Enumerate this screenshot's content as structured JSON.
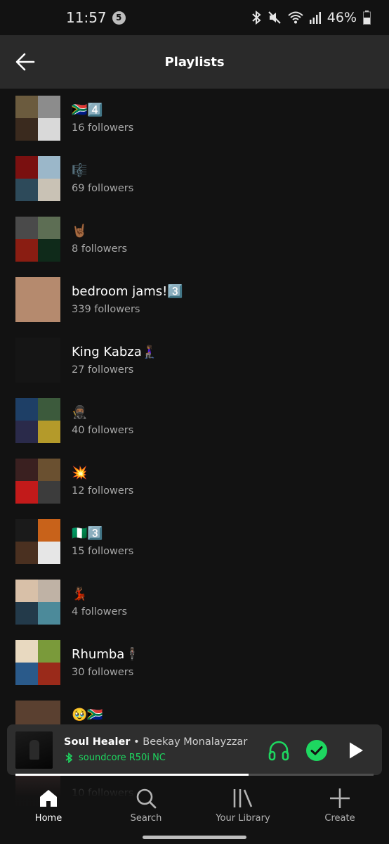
{
  "status_bar": {
    "time": "11:57",
    "notification_count": "5",
    "battery": "46%"
  },
  "header": {
    "title": "Playlists"
  },
  "playlists": [
    {
      "name": "🇿🇦4️⃣",
      "followers": "16 followers",
      "cover": [
        "#6b5b3e",
        "#8c8c8c",
        "#3a2a1e",
        "#d9d9d9"
      ]
    },
    {
      "name": "🎼",
      "followers": "69 followers",
      "cover": [
        "#7a1010",
        "#9bb7c9",
        "#2d4a5a",
        "#c9c2b5"
      ]
    },
    {
      "name": "🤘🏾",
      "followers": "8 followers",
      "cover": [
        "#4a4a4a",
        "#5d6e54",
        "#8a1d12",
        "#0f2a1a"
      ]
    },
    {
      "name": "bedroom jams!3️⃣",
      "followers": "339 followers",
      "cover": [
        "#b58a6e"
      ]
    },
    {
      "name": "King Kabza🧎🏾‍♀️",
      "followers": "27 followers",
      "cover": [
        "#151515"
      ]
    },
    {
      "name": "🥷🏾",
      "followers": "40 followers",
      "cover": [
        "#1e3f66",
        "#3c5a3c",
        "#2a2a4a",
        "#b49a2a"
      ]
    },
    {
      "name": "💥",
      "followers": "12 followers",
      "cover": [
        "#3a2020",
        "#6a5030",
        "#c21a1a",
        "#3c3c3c"
      ]
    },
    {
      "name": "🇳🇬3️⃣",
      "followers": "15 followers",
      "cover": [
        "#1a1a1a",
        "#c8621a",
        "#4a3020",
        "#e6e6e6"
      ]
    },
    {
      "name": "💃🏾",
      "followers": "4 followers",
      "cover": [
        "#d8c0a8",
        "#bfb2a5",
        "#233a4a",
        "#4c8a9a"
      ]
    },
    {
      "name": "Rhumba🕴🏾",
      "followers": "30 followers",
      "cover": [
        "#e8d9c0",
        "#7a9a3a",
        "#2a5a8a",
        "#9a2a1a"
      ]
    },
    {
      "name": "🥹🇿🇦",
      "followers": "",
      "cover": [
        "#5a4030"
      ]
    },
    {
      "name": "",
      "followers": "10 followers",
      "cover": [
        "#3a2a2a"
      ]
    }
  ],
  "now_playing": {
    "title": "Soul Healer",
    "separator": " • ",
    "artist": "Beekay Monalayzzar",
    "device": "soundcore R50i NC",
    "progress": 0.65,
    "accent": "#1ed760"
  },
  "nav": [
    {
      "label": "Home",
      "icon": "home-icon",
      "active": true
    },
    {
      "label": "Search",
      "icon": "search-icon",
      "active": false
    },
    {
      "label": "Your Library",
      "icon": "library-icon",
      "active": false
    },
    {
      "label": "Create",
      "icon": "plus-icon",
      "active": false
    }
  ]
}
